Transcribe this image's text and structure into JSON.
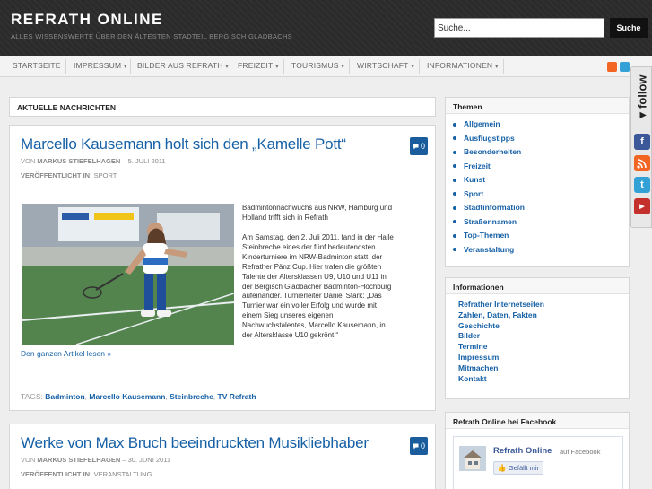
{
  "header": {
    "title": "REFRATH ONLINE",
    "description": "ALLES WISSENSWERTE ÜBER DEN ÄLTESTEN STADTEIL BERGISCH GLADBACHS"
  },
  "search": {
    "value": "Suche...",
    "button_label": "Suche"
  },
  "nav": {
    "items": [
      {
        "label": "STARTSEITE"
      },
      {
        "label": "IMPRESSUM"
      },
      {
        "label": "BILDER AUS REFRATH"
      },
      {
        "label": "FREIZEIT"
      },
      {
        "label": "TOURISMUS"
      },
      {
        "label": "WIRTSCHAFT"
      },
      {
        "label": "INFORMATIONEN"
      }
    ],
    "caret": "▾"
  },
  "main": {
    "section_title": "AKTUELLE NACHRICHTEN",
    "posts": [
      {
        "title": "Marcello Kausemann holt sich den „Kamelle Pott“",
        "comments": "0",
        "by_label": "VON",
        "author": "MARKUS STIEFELHAGEN",
        "date": "– 5. JULI 2011",
        "published_label": "VERÖFFENTLICHT IN:",
        "category": "SPORT",
        "excerpt_p1": "Badmintonnachwuchs aus NRW, Hamburg und Holland trifft sich in Refrath",
        "excerpt_p2": "Am Samstag, den 2. Juli 2011, fand in der Halle Steinbreche eines der fünf bedeutendsten Kinderturniere im NRW-Badminton statt, der Refrather Pänz Cup. Hier trafen die größten Talente der Altersklassen U9, U10 und U11 in der Bergisch Gladbacher Badminton-Hochburg aufeinander. Turnierleiter Daniel Stark: „Das Turnier war ein voller Erfolg und wurde mit einem Sieg unseres eigenen Nachwuchstalentes, Marcello Kausemann, in der Altersklasse U10 gekrönt.“",
        "read_more": "Den ganzen Artikel lesen »",
        "tags_label": "TAGS:",
        "tags": [
          "Badminton",
          "Marcello Kausemann",
          "Steinbreche",
          "TV Refrath"
        ]
      },
      {
        "title": "Werke von Max Bruch beeindruckten Musikliebhaber",
        "comments": "0",
        "by_label": "VON",
        "author": "MARKUS STIEFELHAGEN",
        "date": "– 30. JUNI 2011",
        "published_label": "VERÖFFENTLICHT IN:",
        "category": "VERANSTALTUNG"
      }
    ]
  },
  "sidebar": {
    "themen": {
      "title": "Themen",
      "items": [
        "Allgemein",
        "Ausflugstipps",
        "Besonderheiten",
        "Freizeit",
        "Kunst",
        "Sport",
        "Stadtinformation",
        "Straßennamen",
        "Top-Themen",
        "Veranstaltung"
      ]
    },
    "informationen": {
      "title": "Informationen",
      "items": [
        "Refrather Internetseiten",
        "Zahlen, Daten, Fakten",
        "Geschichte",
        "Bilder",
        "Termine",
        "Impressum",
        "Mitmachen",
        "Kontakt"
      ]
    },
    "facebook": {
      "title": "Refrath Online bei Facebook",
      "page_name": "Refrath Online",
      "on_facebook": "auf Facebook",
      "like_label": "Gefällt mir"
    }
  },
  "follow": {
    "label": "follow",
    "arrow": "◂"
  },
  "colors": {
    "header_bg": "#2b2b2b",
    "link_blue": "#1660a6",
    "badge_blue": "#1a5c9c",
    "facebook": "#3b5998",
    "rss": "#f26522",
    "twitter": "#33a1d6",
    "youtube": "#c4302b"
  }
}
